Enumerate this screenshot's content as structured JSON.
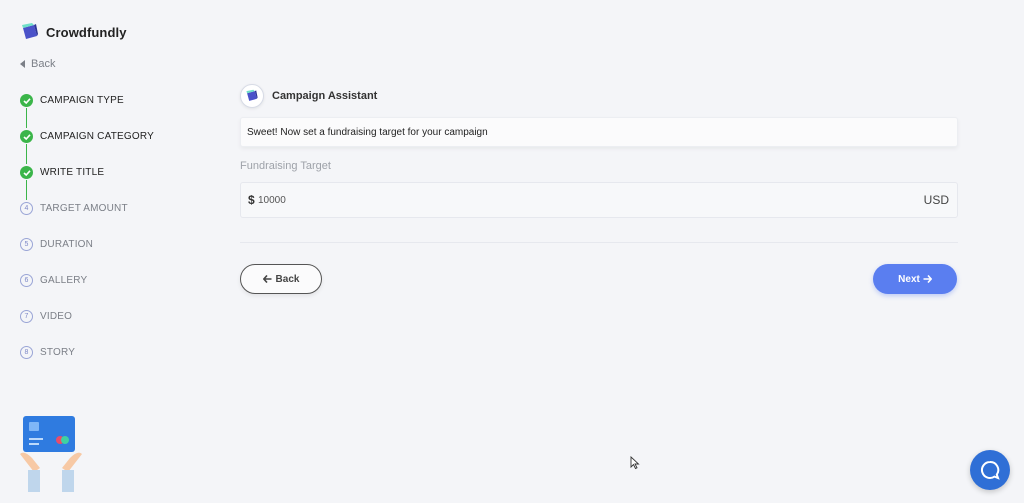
{
  "brand": {
    "name": "Crowdfundly",
    "logo_icon": "crowdfundly-logo-icon"
  },
  "sidebar": {
    "back_label": "Back",
    "steps": [
      {
        "number": "1",
        "label": "CAMPAIGN TYPE",
        "status": "done"
      },
      {
        "number": "2",
        "label": "CAMPAIGN CATEGORY",
        "status": "done"
      },
      {
        "number": "3",
        "label": "WRITE TITLE",
        "status": "done"
      },
      {
        "number": "4",
        "label": "TARGET AMOUNT",
        "status": "pending"
      },
      {
        "number": "5",
        "label": "DURATION",
        "status": "pending"
      },
      {
        "number": "6",
        "label": "GALLERY",
        "status": "pending"
      },
      {
        "number": "7",
        "label": "VIDEO",
        "status": "pending"
      },
      {
        "number": "8",
        "label": "STORY",
        "status": "pending"
      }
    ]
  },
  "assistant": {
    "name": "Campaign Assistant",
    "message": "Sweet! Now set a fundraising target for your campaign"
  },
  "form": {
    "label": "Fundraising Target",
    "currency_symbol": "$",
    "value": "10000",
    "currency_code": "USD"
  },
  "buttons": {
    "back_label": "Back",
    "next_label": "Next"
  },
  "colors": {
    "accent": "#5a7ef0",
    "success": "#3bb54a",
    "chat": "#2f6fd6",
    "background": "#f4f5f8"
  }
}
